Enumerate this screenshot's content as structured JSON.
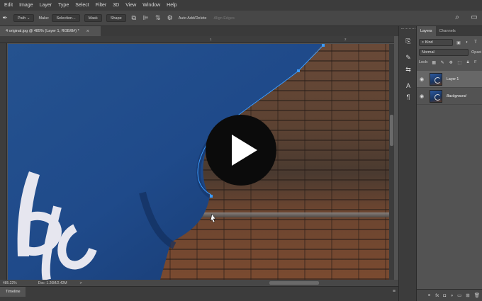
{
  "menu": [
    "Edit",
    "Image",
    "Layer",
    "Type",
    "Select",
    "Filter",
    "3D",
    "View",
    "Window",
    "Help"
  ],
  "options": {
    "mode_value": "Path",
    "make_label": "Make:",
    "selection_btn": "Selection...",
    "mask_btn": "Mask",
    "shape_btn": "Shape",
    "auto_add_delete": "Auto Add/Delete",
    "align_edges": "Align Edges",
    "icons": [
      "pen-tool-icon",
      "path-operations-icon",
      "path-alignment-icon",
      "path-arrangement-icon",
      "gear-icon"
    ]
  },
  "document": {
    "tab_title": "4 original.jpg @ 485% (Layer 1, RGB/8#) *",
    "close_glyph": "×"
  },
  "ruler": {
    "h_tick_1": "1",
    "h_tick_2": "2"
  },
  "status": {
    "zoom": "485.22%",
    "doc_info": "Doc: 1.26M/2.42M",
    "arrow": ">"
  },
  "timeline": {
    "tab_label": "Timeline"
  },
  "panel": {
    "tabs": [
      "Layers",
      "Channels"
    ],
    "filter_kind": "Kind",
    "blend_mode": "Normal",
    "opacity_label": "Opaci",
    "lock_label": "Lock:",
    "fill_label": "F",
    "layers": [
      {
        "name": "Layer 1",
        "visible": true,
        "selected": true
      },
      {
        "name": "Background",
        "visible": true,
        "selected": false
      }
    ]
  },
  "colors": {
    "shirt": "#1f4a8a",
    "overlay": "#0b0b0b",
    "path_anchor": "#3a9bff"
  }
}
